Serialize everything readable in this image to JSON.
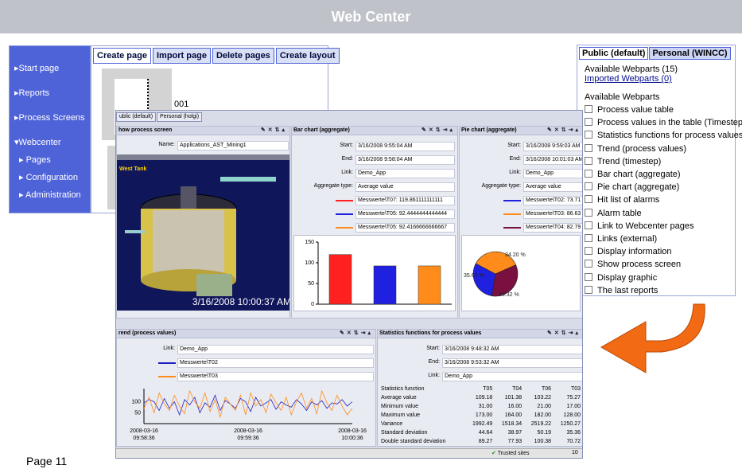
{
  "window": {
    "title": "Web Center"
  },
  "nav": {
    "items": [
      "Start page",
      "Reports",
      "Process Screens",
      "Webcenter",
      "Pages",
      "Configuration",
      "Administration"
    ]
  },
  "page_tabs": [
    "Create page",
    "Import page",
    "Delete pages",
    "Create layout"
  ],
  "page_thumb_label": "001",
  "webparts": {
    "tabs": [
      "Public (default)",
      "Personal (WINCC)"
    ],
    "available_count": "Available Webparts (15)",
    "imported": "Imported Webparts (0)",
    "section": "Available Webparts",
    "items": [
      "Process value table",
      "Process values in the table (Timestep)",
      "Statistics functions for process values",
      "Trend (process values)",
      "Trend (timestep)",
      "Bar chart (aggregate)",
      "Pie chart (aggregate)",
      "Hit list of alarms",
      "Alarm table",
      "Link to Webcenter pages",
      "Links (external)",
      "Display information",
      "Show process screen",
      "Display graphic",
      "The last reports"
    ]
  },
  "shot": {
    "tabs": [
      "ublic (default)",
      "Personal (holgi)"
    ],
    "process": {
      "title": "how process screen",
      "name_label": "Name:",
      "name_value": "Applications_AST_Mining1",
      "tank_label": "West Tank",
      "timestamp": "3/16/2008 10:00:37 AM"
    },
    "bar": {
      "title": "Bar chart (aggregate)",
      "start_label": "Start:",
      "start": "3/16/2008 9:55:04 AM",
      "end_label": "End:",
      "end": "3/16/2008 9:58:04 AM",
      "link_label": "Link:",
      "link": "Demo_App",
      "agg_label": "Aggregate type:",
      "agg": "Average value",
      "legend": [
        {
          "label": "Messwerte\\T07: 119.861111111111",
          "color": "#ff2020"
        },
        {
          "label": "Messwerte\\T05: 92.4444444444444",
          "color": "#2020e0"
        },
        {
          "label": "Messwerte\\T05: 92.4166666666667",
          "color": "#ff8c1a"
        }
      ]
    },
    "pie": {
      "title": "Pie chart (aggregate)",
      "start_label": "Start:",
      "start": "3/16/2008 9:59:03 AM",
      "end_label": "End:",
      "end": "3/16/2008 10:01:03 AM",
      "link_label": "Link:",
      "link": "Demo_App",
      "agg_label": "Aggregate type:",
      "agg": "Average value",
      "legend": [
        {
          "label": "Messwerte\\T02: 73.71",
          "color": "#2020e0"
        },
        {
          "label": "Messwerte\\T03: 86.63",
          "color": "#ff8c1a"
        },
        {
          "label": "Messwerte\\T04: 82.79",
          "color": "#7a1040"
        }
      ],
      "slice_labels": [
        "34.20 %",
        "35.63 %",
        "30.32 %"
      ]
    },
    "trend": {
      "title": "rend (process values)",
      "link_label": "Link:",
      "link": "Demo_App",
      "legend": [
        {
          "label": "Messwerte\\T02",
          "color": "#2020c0"
        },
        {
          "label": "Messwerte\\T03",
          "color": "#ff8c1a"
        }
      ],
      "ticks_y": [
        "100",
        "50"
      ],
      "ticks_x": [
        "2008-03-16\n09:58:36",
        "2008-03-16\n09:59:36",
        "2008-03-16\n10:00:36"
      ]
    },
    "stats": {
      "title": "Statistics functions for process values",
      "start_label": "Start:",
      "start": "3/16/2008 9:48:32 AM",
      "end_label": "End:",
      "end": "3/16/2008 9:53:32 AM",
      "link_label": "Link:",
      "link": "Demo_App",
      "header": [
        "Statistics function",
        "T05",
        "T04",
        "T06",
        "T03"
      ],
      "rows": [
        [
          "Average value",
          "109.18",
          "101.38",
          "103.22",
          "75.27"
        ],
        [
          "Minimum value",
          "31.00",
          "16.00",
          "21.00",
          "17.00"
        ],
        [
          "Maximum value",
          "173.00",
          "164.00",
          "182.00",
          "128.00"
        ],
        [
          "Variance",
          "1992.49",
          "1518.34",
          "2519.22",
          "1250.27"
        ],
        [
          "Standard deviation",
          "44.64",
          "38.97",
          "50.19",
          "35.36"
        ],
        [
          "Double standard deviation",
          "89.27",
          "77.93",
          "100.38",
          "70.72"
        ]
      ]
    },
    "statusbar": {
      "zone": "Trusted sites",
      "zoom": "10"
    }
  },
  "chart_data": [
    {
      "type": "bar",
      "categories": [
        "T07",
        "T05",
        "T05"
      ],
      "values": [
        119.861111111111,
        92.4444444444444,
        92.4166666666667
      ],
      "ylim": [
        0,
        150
      ],
      "ticks": [
        "0",
        "50",
        "100",
        "150"
      ],
      "colors": [
        "#ff2020",
        "#2020e0",
        "#ff8c1a"
      ]
    },
    {
      "type": "pie",
      "labels": [
        "T02",
        "T03",
        "T04"
      ],
      "values": [
        30.32,
        35.63,
        34.2
      ],
      "colors": [
        "#2020e0",
        "#ff8c1a",
        "#7a1040"
      ]
    },
    {
      "type": "line",
      "ylim": [
        0,
        160
      ],
      "series": [
        {
          "name": "Messwerte\\T02",
          "color": "#2020c0",
          "values": [
            95,
            110,
            100,
            60,
            115,
            70,
            100,
            40,
            110,
            85,
            120,
            50,
            95,
            75,
            130,
            60,
            105,
            90,
            70,
            115,
            100,
            55,
            120,
            80,
            95,
            110,
            65,
            100,
            85,
            75,
            110,
            90,
            60,
            100,
            85,
            105,
            70,
            95,
            90,
            110,
            80,
            100
          ]
        },
        {
          "name": "Messwerte\\T03",
          "color": "#ff8c1a",
          "values": [
            70,
            120,
            50,
            140,
            90,
            60,
            130,
            80,
            45,
            150,
            100,
            70,
            140,
            55,
            110,
            30,
            120,
            90,
            60,
            130,
            40,
            140,
            80,
            110,
            50,
            135,
            95,
            60,
            120,
            40,
            100,
            140,
            70,
            115,
            45,
            150,
            95,
            60,
            130,
            80,
            40,
            70
          ]
        }
      ]
    }
  ],
  "footer": {
    "page": "Page 11"
  }
}
